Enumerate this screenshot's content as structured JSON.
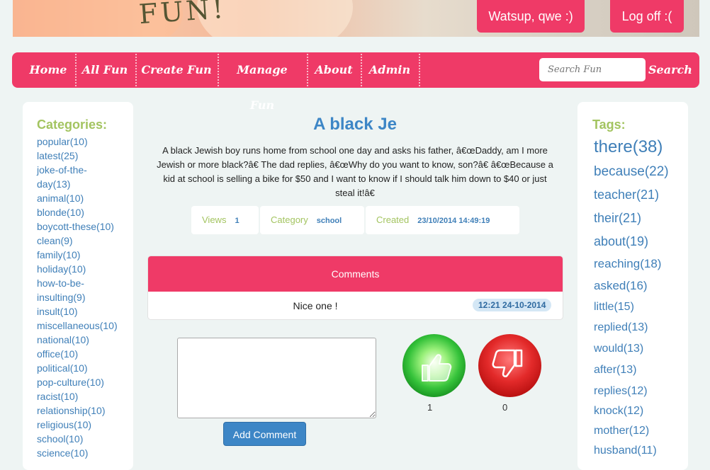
{
  "header": {
    "banner_text": "FUN!",
    "greeting": "Watsup, qwe :)",
    "logoff": "Log off :("
  },
  "nav": {
    "items": [
      "Home",
      "All Fun",
      "Create Fun",
      "Manage Fun",
      "About",
      "Admin"
    ],
    "search_placeholder": "Search Fun",
    "search_button": "Search"
  },
  "categories": {
    "title": "Categories:",
    "items": [
      "popular(10)",
      "latest(25)",
      "joke-of-the-",
      "day(13)",
      "animal(10)",
      "blonde(10)",
      "boycott-these(10)",
      "clean(9)",
      "family(10)",
      "holiday(10)",
      "how-to-be-",
      "insulting(9)",
      "insult(10)",
      "miscellaneous(10)",
      "national(10)",
      "office(10)",
      "political(10)",
      "pop-culture(10)",
      "racist(10)",
      "relationship(10)",
      "religious(10)",
      "school(10)",
      "science(10)"
    ]
  },
  "tags": {
    "title": "Tags:",
    "items": [
      {
        "label": "there(38)",
        "size": 24
      },
      {
        "label": "because(22)",
        "size": 19
      },
      {
        "label": "teacher(21)",
        "size": 18
      },
      {
        "label": "their(21)",
        "size": 18
      },
      {
        "label": "about(19)",
        "size": 18
      },
      {
        "label": "reaching(18)",
        "size": 17
      },
      {
        "label": "asked(16)",
        "size": 17
      },
      {
        "label": "little(15)",
        "size": 16
      },
      {
        "label": "replied(13)",
        "size": 16
      },
      {
        "label": "would(13)",
        "size": 16
      },
      {
        "label": "after(13)",
        "size": 16
      },
      {
        "label": "replies(12)",
        "size": 16
      },
      {
        "label": "knock(12)",
        "size": 16
      },
      {
        "label": "mother(12)",
        "size": 16
      },
      {
        "label": "husband(11)",
        "size": 16
      }
    ]
  },
  "joke": {
    "title": "A black Je",
    "text": "A black Jewish boy runs home from school one day and asks his father, â€œDaddy, am I more Jewish or more black?â€ The dad replies, â€œWhy do you want to know, son?â€ â€œBecause a kid at school is selling a bike for $50 and I want to know if I should talk him down to $40 or just steal it!â€",
    "views_label": "Views",
    "views": "1",
    "category_label": "Category",
    "category": "school",
    "created_label": "Created",
    "created": "23/10/2014 14:49:19"
  },
  "comments": {
    "title": "Comments",
    "list": [
      {
        "text": "Nice one !",
        "time": "12:21 24-10-2014"
      }
    ],
    "add_button": "Add Comment"
  },
  "votes": {
    "up_count": "1",
    "down_count": "0",
    "up_icon": "thumbs-up-icon",
    "down_icon": "thumbs-down-icon"
  },
  "colors": {
    "accent": "#ef3a67",
    "link": "#3f7fb8",
    "heading_green": "#a3c460",
    "title_blue": "#3d86c6"
  }
}
